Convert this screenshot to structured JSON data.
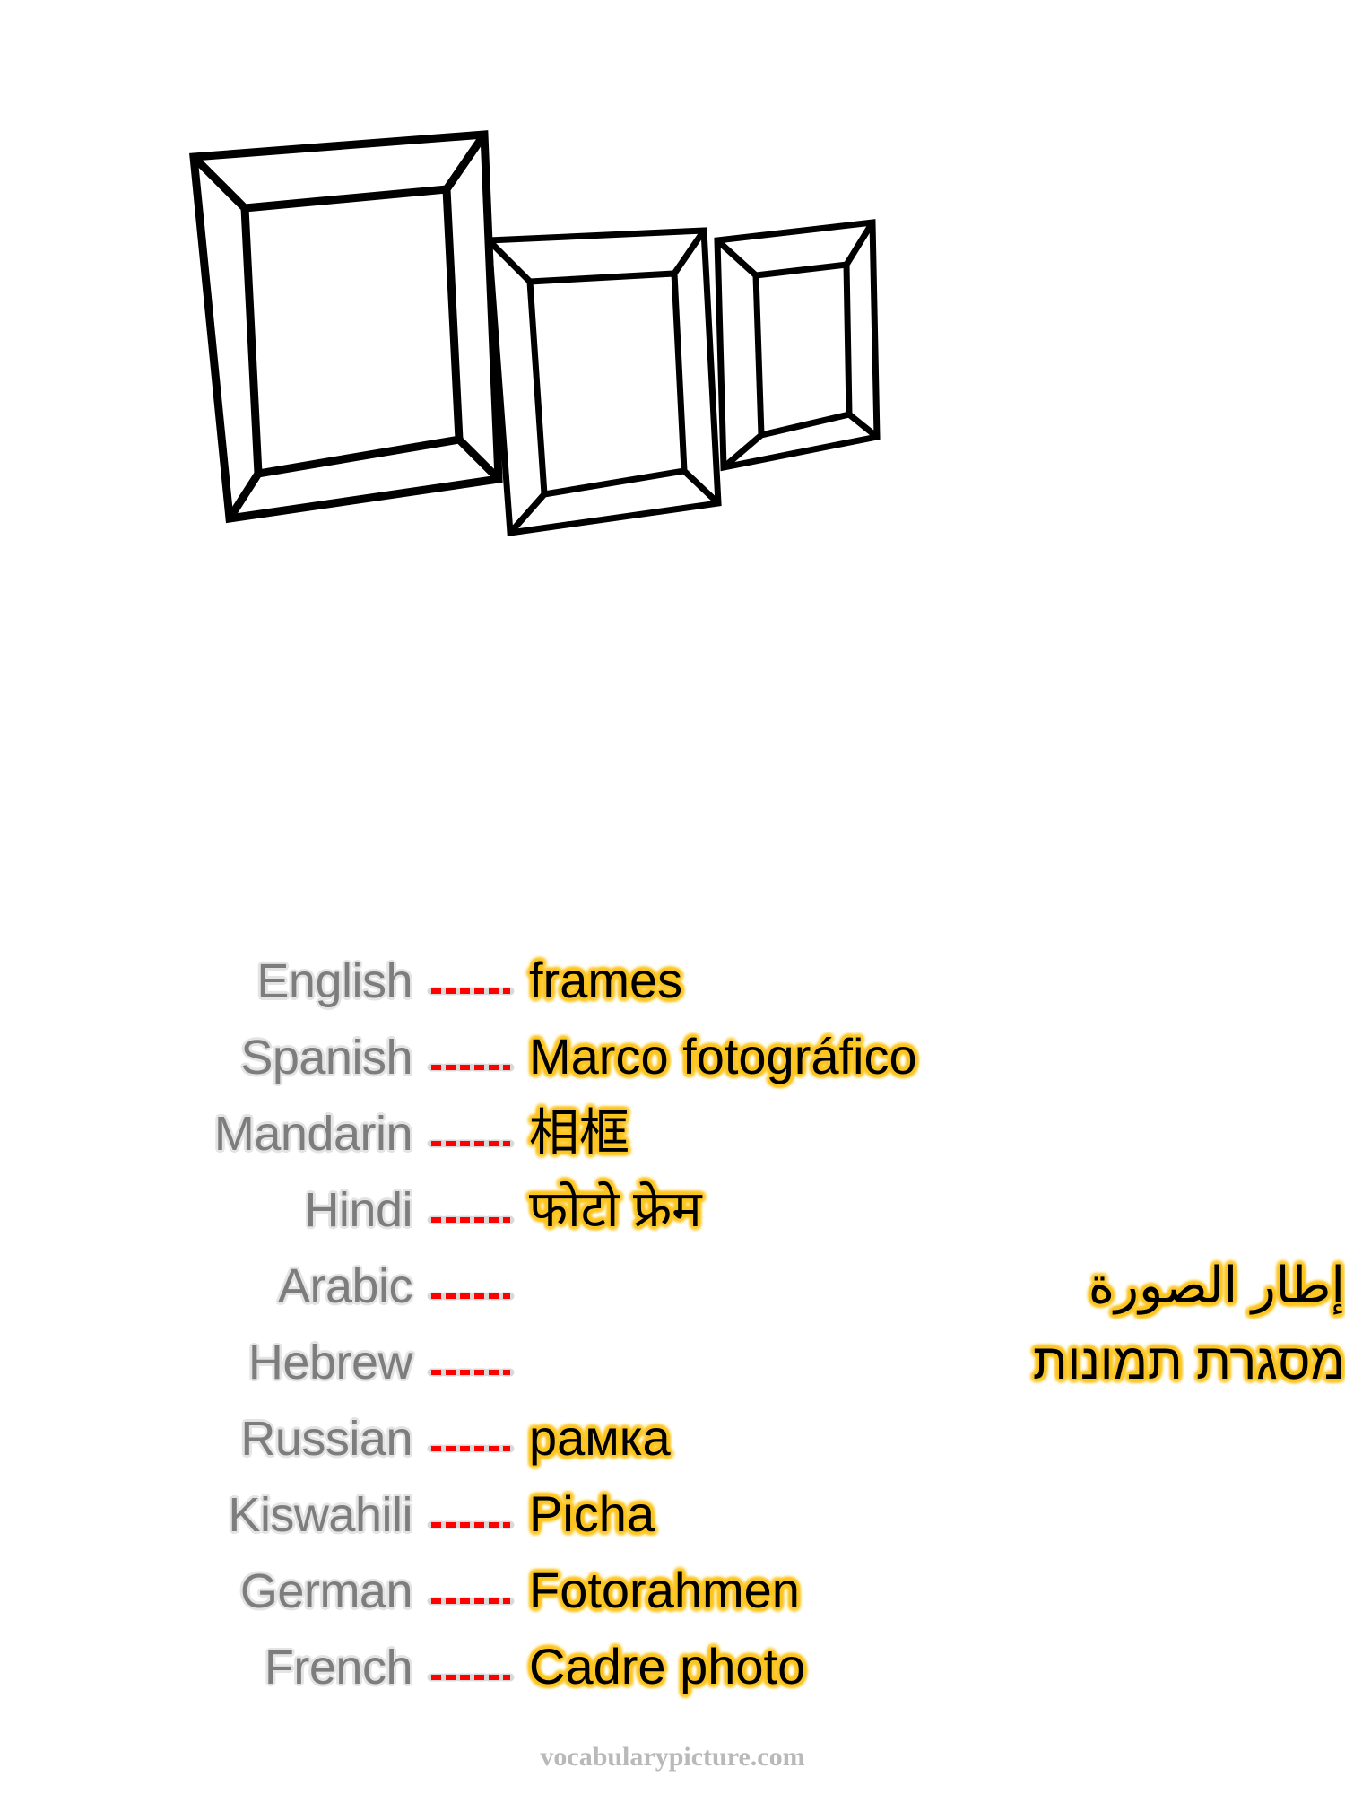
{
  "illustration": {
    "name": "three-picture-frames-line-drawing",
    "description": "Three empty rectangular picture frames drawn in black outline on white, arranged left to right in decreasing size and overlapping",
    "stroke_color": "#000000",
    "fill_color": "#ffffff"
  },
  "separator": {
    "glyph": "------",
    "color": "#ff0000",
    "outline_color": "#d9d9d9",
    "dash_count": 6
  },
  "vocab": {
    "rows": [
      {
        "language": "English",
        "word": "frames",
        "rtl": false
      },
      {
        "language": "Spanish",
        "word": "Marco fotográfico",
        "rtl": false
      },
      {
        "language": "Mandarin",
        "word": "相框",
        "rtl": false
      },
      {
        "language": "Hindi",
        "word": "फोटो फ्रेम",
        "rtl": false
      },
      {
        "language": "Arabic",
        "word": "إطار الصورة",
        "rtl": true
      },
      {
        "language": "Hebrew",
        "word": "מסגרת תמונות",
        "rtl": true
      },
      {
        "language": "Russian",
        "word": "рамка",
        "rtl": false
      },
      {
        "language": "Kiswahili",
        "word": "Picha",
        "rtl": false
      },
      {
        "language": "German",
        "word": "Fotorahmen",
        "rtl": false
      },
      {
        "language": "French",
        "word": "Cadre photo",
        "rtl": false
      }
    ]
  },
  "footer": {
    "watermark": "vocabularypicture.com"
  },
  "colors": {
    "label_text": "#7d7d7d",
    "label_outline": "#e4e4e4",
    "word_text": "#000000",
    "word_glow": "#fcc521",
    "dash": "#ff0000",
    "footer_text": "#b9b9b9",
    "background": "#ffffff"
  }
}
